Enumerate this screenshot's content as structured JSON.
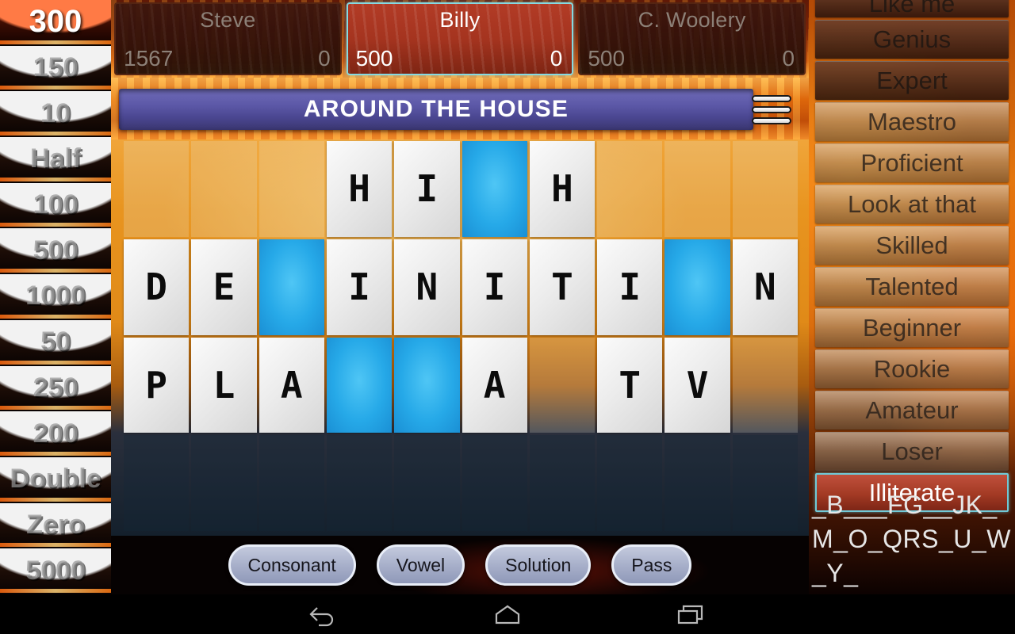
{
  "scoreboard": {
    "players": [
      {
        "name": "Steve",
        "total": "1567",
        "round": "0",
        "active": false
      },
      {
        "name": "Billy",
        "total": "500",
        "round": "0",
        "active": true
      },
      {
        "name": "C. Woolery",
        "total": "500",
        "round": "0",
        "active": false
      }
    ]
  },
  "wheel": {
    "segments": [
      {
        "value": "300",
        "highlighted": true
      },
      {
        "value": "150",
        "highlighted": false
      },
      {
        "value": "10",
        "highlighted": false
      },
      {
        "value": "Half",
        "highlighted": false
      },
      {
        "value": "100",
        "highlighted": false
      },
      {
        "value": "500",
        "highlighted": false
      },
      {
        "value": "1000",
        "highlighted": false
      },
      {
        "value": "50",
        "highlighted": false
      },
      {
        "value": "250",
        "highlighted": false
      },
      {
        "value": "200",
        "highlighted": false
      },
      {
        "value": "Double",
        "highlighted": false
      },
      {
        "value": "Zero",
        "highlighted": false
      },
      {
        "value": "5000",
        "highlighted": false
      }
    ]
  },
  "ranks": {
    "items": [
      {
        "label": "Like me",
        "style": "dark",
        "clipped": true
      },
      {
        "label": "Genius",
        "style": "dark",
        "clipped": false
      },
      {
        "label": "Expert",
        "style": "dark",
        "clipped": false
      },
      {
        "label": "Maestro",
        "style": "normal",
        "clipped": false
      },
      {
        "label": "Proficient",
        "style": "normal",
        "clipped": false
      },
      {
        "label": "Look at that",
        "style": "normal",
        "clipped": false
      },
      {
        "label": "Skilled",
        "style": "normal",
        "clipped": false
      },
      {
        "label": "Talented",
        "style": "normal",
        "clipped": false
      },
      {
        "label": "Beginner",
        "style": "normal",
        "clipped": false
      },
      {
        "label": "Rookie",
        "style": "normal",
        "clipped": false
      },
      {
        "label": "Amateur",
        "style": "normal",
        "clipped": false
      },
      {
        "label": "Loser",
        "style": "normal",
        "clipped": false
      },
      {
        "label": "Illiterate",
        "style": "current",
        "clipped": false
      }
    ]
  },
  "letters": {
    "remaining": "_B___FG__JK_M_O_QRS_U_W_Y_"
  },
  "category": {
    "label": "AROUND THE HOUSE"
  },
  "menu": {
    "icon": "hamburger-menu-icon"
  },
  "board": {
    "columns": 10,
    "rows": [
      [
        {
          "letter": "",
          "state": "empty"
        },
        {
          "letter": "",
          "state": "empty"
        },
        {
          "letter": "",
          "state": "empty"
        },
        {
          "letter": "H",
          "state": "filled"
        },
        {
          "letter": "I",
          "state": "filled"
        },
        {
          "letter": "",
          "state": "active"
        },
        {
          "letter": "H",
          "state": "filled"
        },
        {
          "letter": "",
          "state": "empty"
        },
        {
          "letter": "",
          "state": "empty"
        },
        {
          "letter": "",
          "state": "empty"
        }
      ],
      [
        {
          "letter": "D",
          "state": "filled"
        },
        {
          "letter": "E",
          "state": "filled"
        },
        {
          "letter": "",
          "state": "active"
        },
        {
          "letter": "I",
          "state": "filled"
        },
        {
          "letter": "N",
          "state": "filled"
        },
        {
          "letter": "I",
          "state": "filled"
        },
        {
          "letter": "T",
          "state": "filled"
        },
        {
          "letter": "I",
          "state": "filled"
        },
        {
          "letter": "",
          "state": "active"
        },
        {
          "letter": "N",
          "state": "filled"
        }
      ],
      [
        {
          "letter": "P",
          "state": "filled"
        },
        {
          "letter": "L",
          "state": "filled"
        },
        {
          "letter": "A",
          "state": "filled"
        },
        {
          "letter": "",
          "state": "active"
        },
        {
          "letter": "",
          "state": "active"
        },
        {
          "letter": "A",
          "state": "filled"
        },
        {
          "letter": "",
          "state": "empty"
        },
        {
          "letter": "T",
          "state": "filled"
        },
        {
          "letter": "V",
          "state": "filled"
        },
        {
          "letter": "",
          "state": "empty"
        }
      ],
      [
        {
          "letter": "",
          "state": "empty-dark"
        },
        {
          "letter": "",
          "state": "empty-dark"
        },
        {
          "letter": "",
          "state": "empty-dark"
        },
        {
          "letter": "",
          "state": "empty-dark"
        },
        {
          "letter": "",
          "state": "empty-dark"
        },
        {
          "letter": "",
          "state": "empty-dark"
        },
        {
          "letter": "",
          "state": "empty-dark"
        },
        {
          "letter": "",
          "state": "empty-dark"
        },
        {
          "letter": "",
          "state": "empty-dark"
        },
        {
          "letter": "",
          "state": "empty-dark"
        }
      ]
    ]
  },
  "actions": {
    "buttons": [
      {
        "label": "Consonant",
        "name": "consonant-button"
      },
      {
        "label": "Vowel",
        "name": "vowel-button"
      },
      {
        "label": "Solution",
        "name": "solution-button"
      },
      {
        "label": "Pass",
        "name": "pass-button"
      }
    ]
  },
  "navbar": {
    "back": "back-icon",
    "home": "home-icon",
    "recents": "recents-icon"
  },
  "colors": {
    "accent_blue": "#26a9e8",
    "active_border": "#6fc9d6",
    "banner_purple": "#5b57a6",
    "fire_orange": "#e8740e",
    "wheel_highlight": "#8f2408"
  }
}
